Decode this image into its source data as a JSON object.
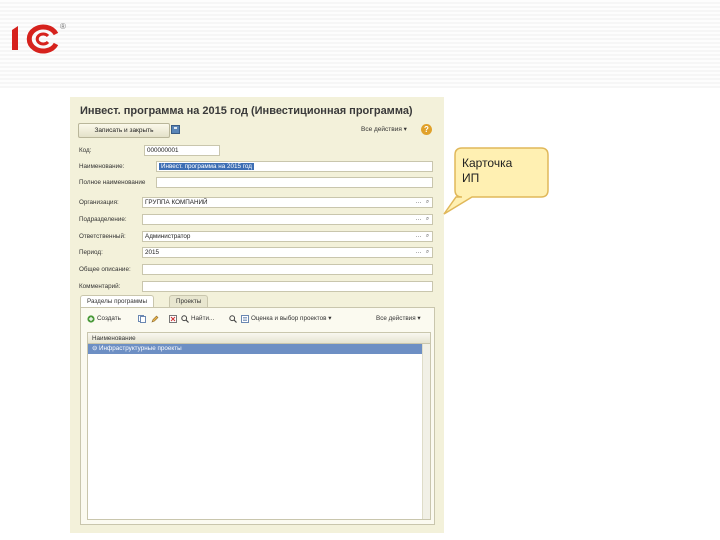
{
  "brand": {
    "logo_text": "1С",
    "trademark": "®",
    "accent": "#d6221d"
  },
  "window": {
    "title": "Инвест. программа на 2015 год (Инвестиционная программа)",
    "save_close_button": "Записать и закрыть",
    "all_actions": "Все действия ▾",
    "help": "?"
  },
  "form": {
    "code": {
      "label": "Код:",
      "value": "000000001"
    },
    "name": {
      "label": "Наименование:",
      "value": "Инвест. программа на 2015 год"
    },
    "full_name": {
      "label": "Полное наименование",
      "value": ""
    },
    "organization": {
      "label": "Организация:",
      "value": "ГРУППА КОМПАНИЙ"
    },
    "department": {
      "label": "Подразделение:",
      "value": ""
    },
    "responsible": {
      "label": "Ответственный:",
      "value": "Администратор"
    },
    "period": {
      "label": "Период:",
      "value": "2015"
    },
    "general_description": {
      "label": "Общее описание:",
      "value": ""
    },
    "comment": {
      "label": "Комментарий:",
      "value": ""
    }
  },
  "tabs": [
    {
      "label": "Разделы программы",
      "active": true
    },
    {
      "label": "Проекты",
      "active": false
    }
  ],
  "toolbar": {
    "create": "Создать",
    "find": "Найти...",
    "evaluate": "Оценка и выбор проектов ▾",
    "all_actions": "Все действия ▾"
  },
  "table": {
    "header": "Наименование",
    "rows": [
      "Инфраструктурные проекты"
    ]
  },
  "callout": {
    "text_line1": "Карточка",
    "text_line2": "ИП",
    "fill": "#fff0b2",
    "stroke": "#e0b85a"
  }
}
